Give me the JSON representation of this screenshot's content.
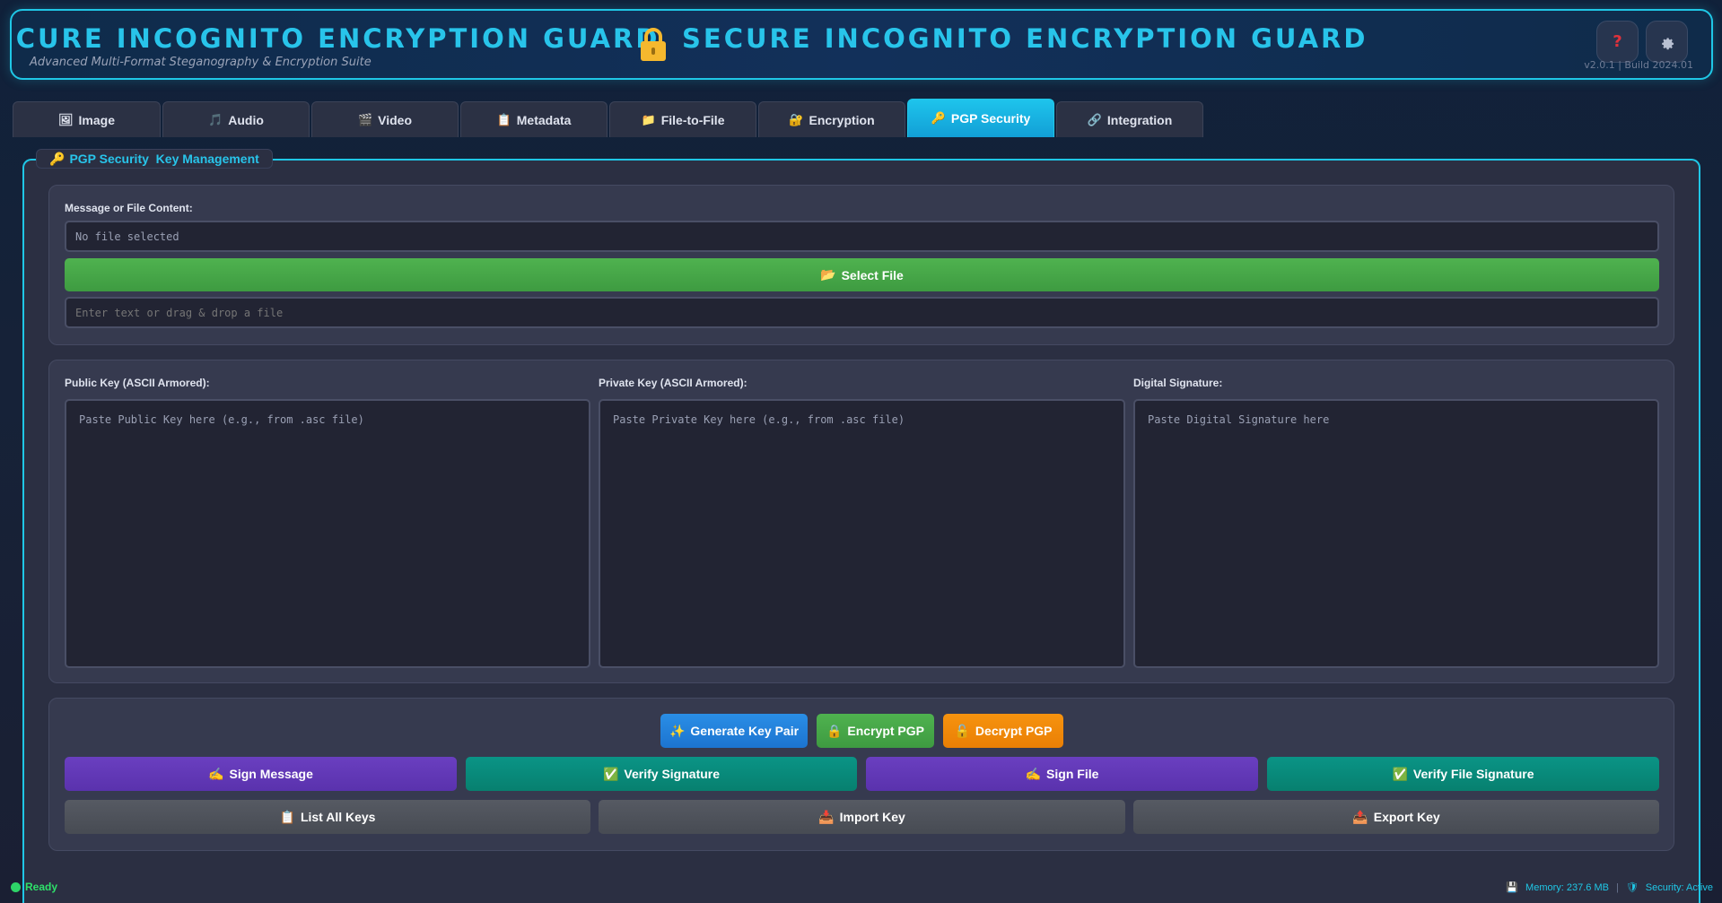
{
  "header": {
    "title_scrolled": "SECURE INCOGNITO ENCRYPTION GUARD",
    "title": "SECURE INCOGNITO ENCRYPTION GUARD",
    "subtitle": "Advanced Multi-Format Steganography & Encryption Suite",
    "version": "v2.0.1 | Build 2024.01",
    "help_icon": "?",
    "settings_icon": "gear-icon"
  },
  "tabs": [
    {
      "label": "Image",
      "icon": "🖼"
    },
    {
      "label": "Audio",
      "icon": "🎵"
    },
    {
      "label": "Video",
      "icon": "🎬"
    },
    {
      "label": "Metadata",
      "icon": "📋"
    },
    {
      "label": "File-to-File",
      "icon": "📁"
    },
    {
      "label": "Encryption",
      "icon": "🔐"
    },
    {
      "label": "PGP Security",
      "icon": "🔑",
      "active": true
    },
    {
      "label": "Integration",
      "icon": "🔗"
    }
  ],
  "panel": {
    "legend": "PGP Security  Key Management",
    "legend_icon": "🔑"
  },
  "message": {
    "label": "Message or File Content:",
    "file_value": "No file selected",
    "select_button": "Select File",
    "select_icon": "📂",
    "text_placeholder": "Enter text or drag & drop a file"
  },
  "keys": {
    "public_label": "Public Key (ASCII Armored):",
    "public_placeholder": "Paste Public Key here (e.g., from .asc file)",
    "private_label": "Private Key (ASCII Armored):",
    "private_placeholder": "Paste Private Key here (e.g., from .asc file)",
    "signature_label": "Digital Signature:",
    "signature_placeholder": "Paste Digital Signature here"
  },
  "actions": {
    "generate": "Generate Key Pair",
    "generate_icon": "✨",
    "encrypt": "Encrypt PGP",
    "encrypt_icon": "🔒",
    "decrypt": "Decrypt PGP",
    "decrypt_icon": "🔓",
    "sign_message": "Sign Message",
    "sign_message_icon": "✍",
    "verify_signature": "Verify Signature",
    "verify_signature_icon": "✅",
    "sign_file": "Sign File",
    "sign_file_icon": "✍",
    "verify_file_signature": "Verify File Signature",
    "verify_file_signature_icon": "✅",
    "list_keys": "List All Keys",
    "list_keys_icon": "📋",
    "import_key": "Import Key",
    "import_key_icon": "📥",
    "export_key": "Export Key",
    "export_key_icon": "📤"
  },
  "status": {
    "ready": "Ready",
    "memory": "Memory: 237.6 MB",
    "memory_icon": "💾",
    "security": "Security: Active",
    "security_icon": "🛡",
    "separator": "|"
  },
  "colors": {
    "accent": "#1fc7e6",
    "green": "#3e9b41",
    "blue": "#1c74d0",
    "orange": "#ea7f05",
    "purple": "#5a32ad",
    "teal": "#07806f"
  }
}
